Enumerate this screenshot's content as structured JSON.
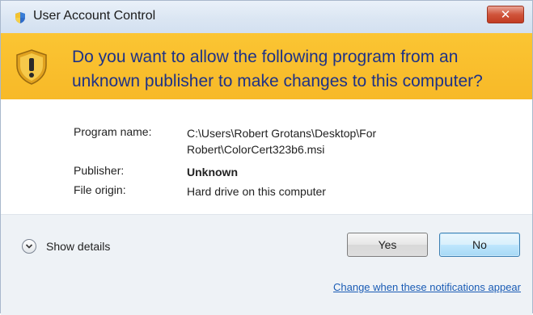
{
  "window": {
    "title": "User Account Control",
    "close_glyph": "✕"
  },
  "banner": {
    "question": "Do you want to allow the following program from an unknown publisher to make changes to this computer?",
    "icon": "uac-shield-warning-icon",
    "background_color": "#f7bc2c",
    "text_color": "#1e3287"
  },
  "details": {
    "program_name_label": "Program name:",
    "program_name_line1": "C:\\Users\\Robert Grotans\\Desktop\\For",
    "program_name_line2": "Robert\\ColorCert323b6.msi",
    "publisher_label": "Publisher:",
    "publisher_value": "Unknown",
    "file_origin_label": "File origin:",
    "file_origin_value": "Hard drive on this computer"
  },
  "footer": {
    "show_details_label": "Show details",
    "yes_label": "Yes",
    "no_label": "No",
    "notifications_link": "Change when these notifications appear",
    "link_color": "#1a5cb5"
  }
}
